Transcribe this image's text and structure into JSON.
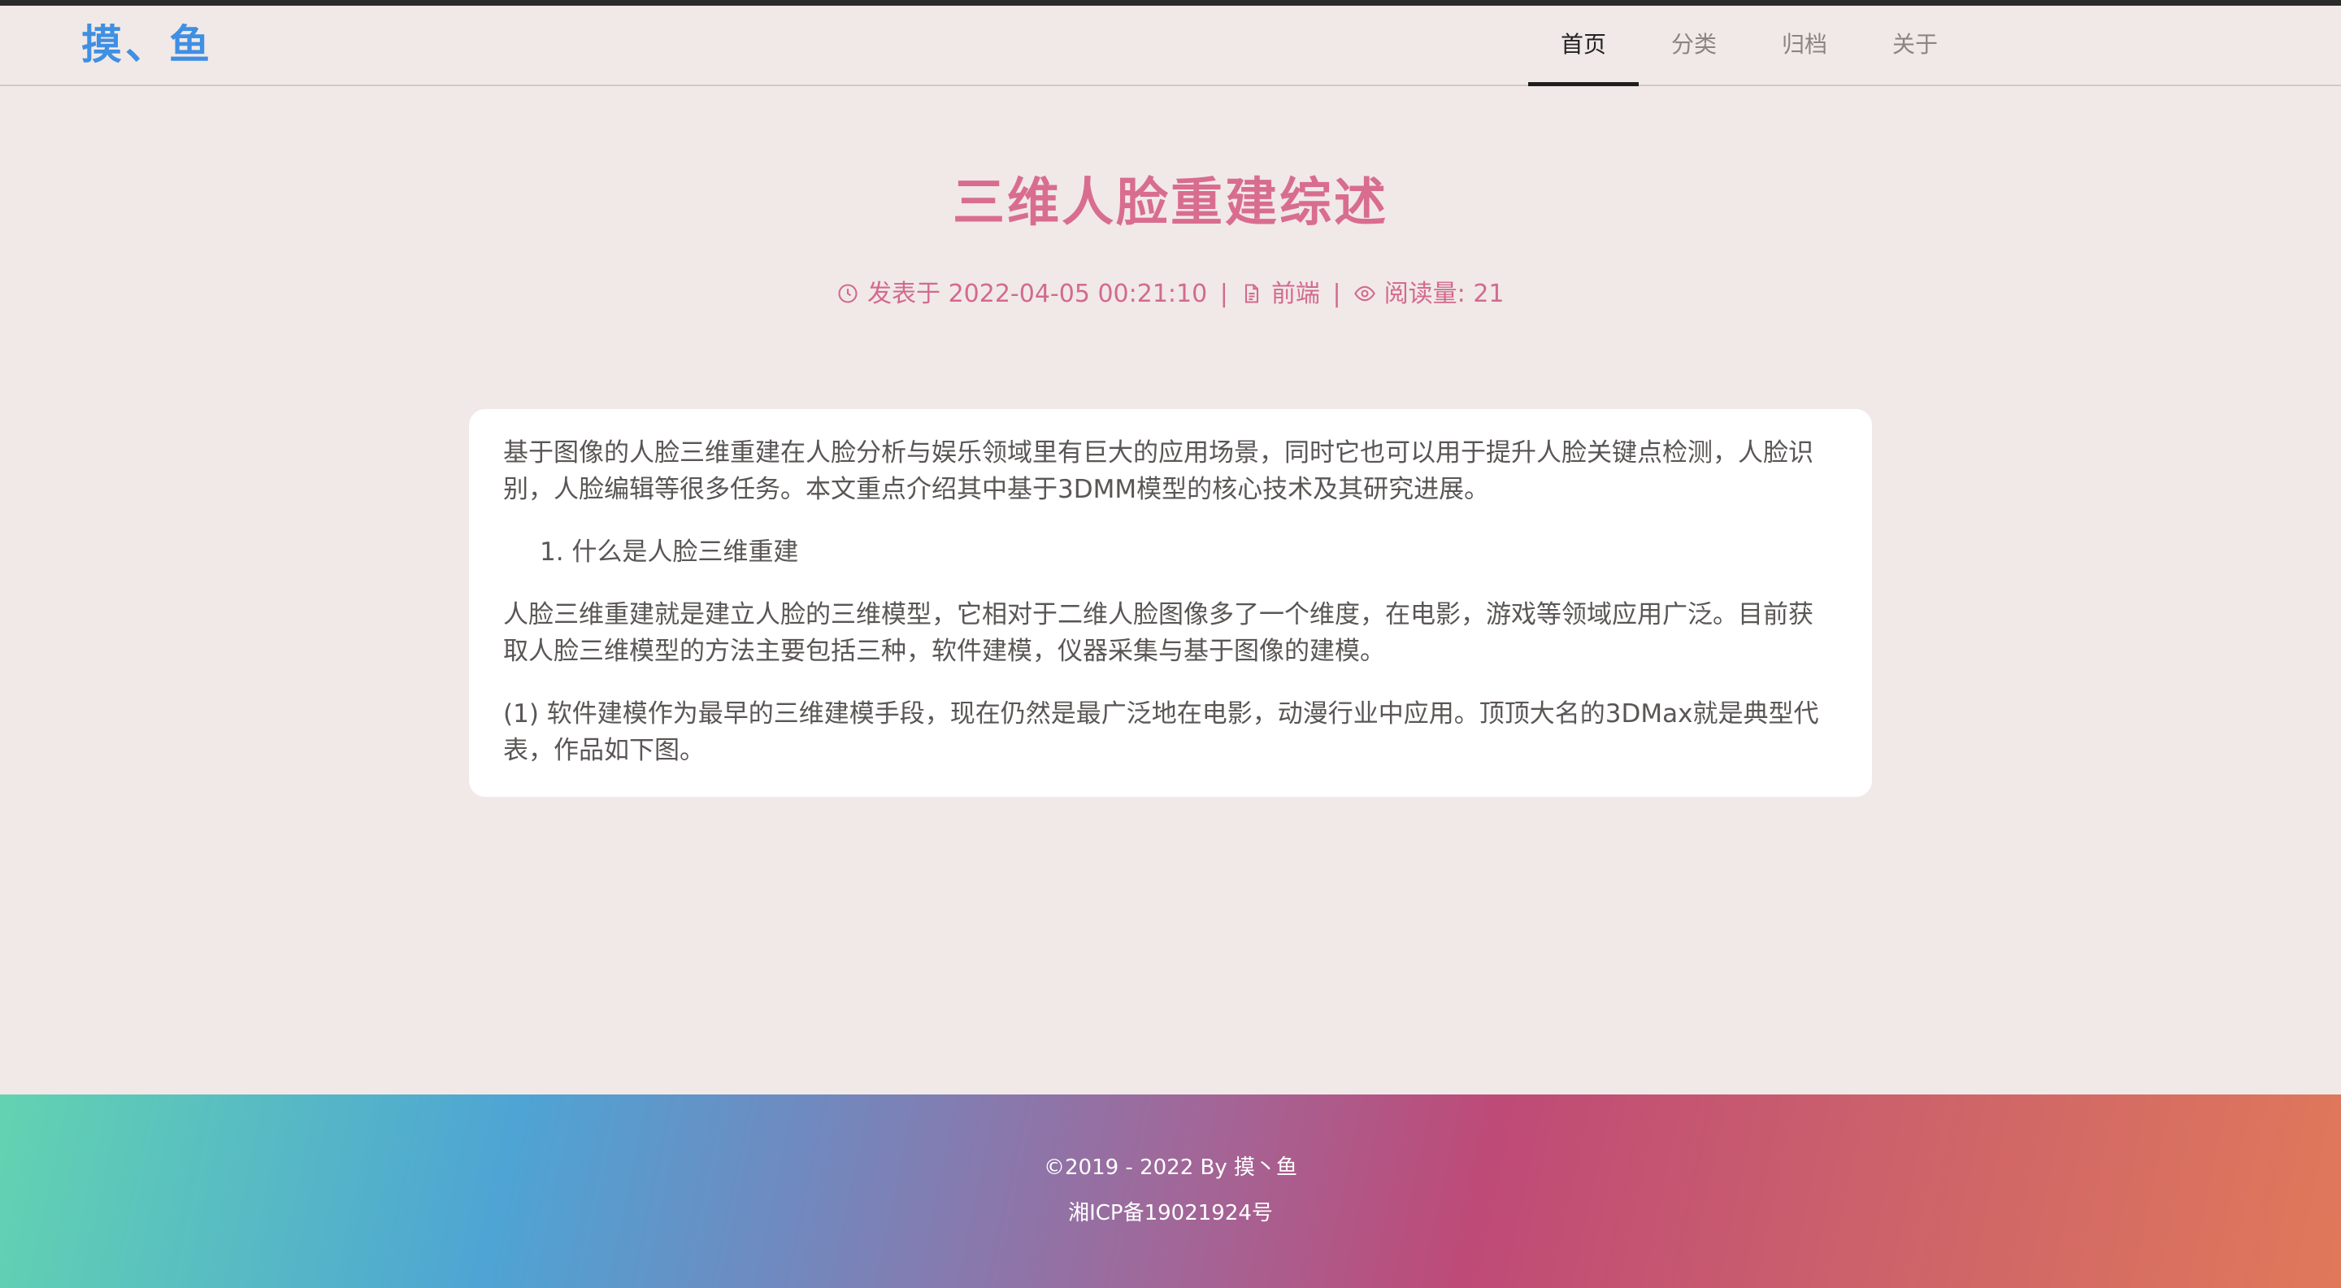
{
  "site": {
    "brand": "摸、鱼"
  },
  "nav": {
    "items": [
      {
        "label": "首页",
        "active": true
      },
      {
        "label": "分类",
        "active": false
      },
      {
        "label": "归档",
        "active": false
      },
      {
        "label": "关于",
        "active": false
      }
    ]
  },
  "post": {
    "title": "三维人脸重建综述",
    "meta": {
      "published_prefix": "发表于",
      "published_at": "2022-04-05 00:21:10",
      "category": "前端",
      "views_label": "阅读量:",
      "views": "21"
    },
    "content": {
      "p1": "基于图像的人脸三维重建在人脸分析与娱乐领域里有巨大的应用场景，同时它也可以用于提升人脸关键点检测，人脸识别，人脸编辑等很多任务。本文重点介绍其中基于3DMM模型的核心技术及其研究进展。",
      "list_item_1": "1. 什么是人脸三维重建",
      "p2": "人脸三维重建就是建立人脸的三维模型，它相对于二维人脸图像多了一个维度，在电影，游戏等领域应用广泛。目前获取人脸三维模型的方法主要包括三种，软件建模，仪器采集与基于图像的建模。",
      "p3": "(1) 软件建模作为最早的三维建模手段，现在仍然是最广泛地在电影，动漫行业中应用。顶顶大名的3DMax就是典型代表，作品如下图。"
    }
  },
  "footer": {
    "copyright": "©2019 - 2022 By 摸丶鱼",
    "icp": "湘ICP备19021924号"
  },
  "colors": {
    "brand": "#3f8fe3",
    "title": "#d86d8f",
    "meta": "#d26a90",
    "background": "#f1e9e7"
  },
  "icons": [
    "clock-icon",
    "document-icon",
    "eye-icon"
  ]
}
